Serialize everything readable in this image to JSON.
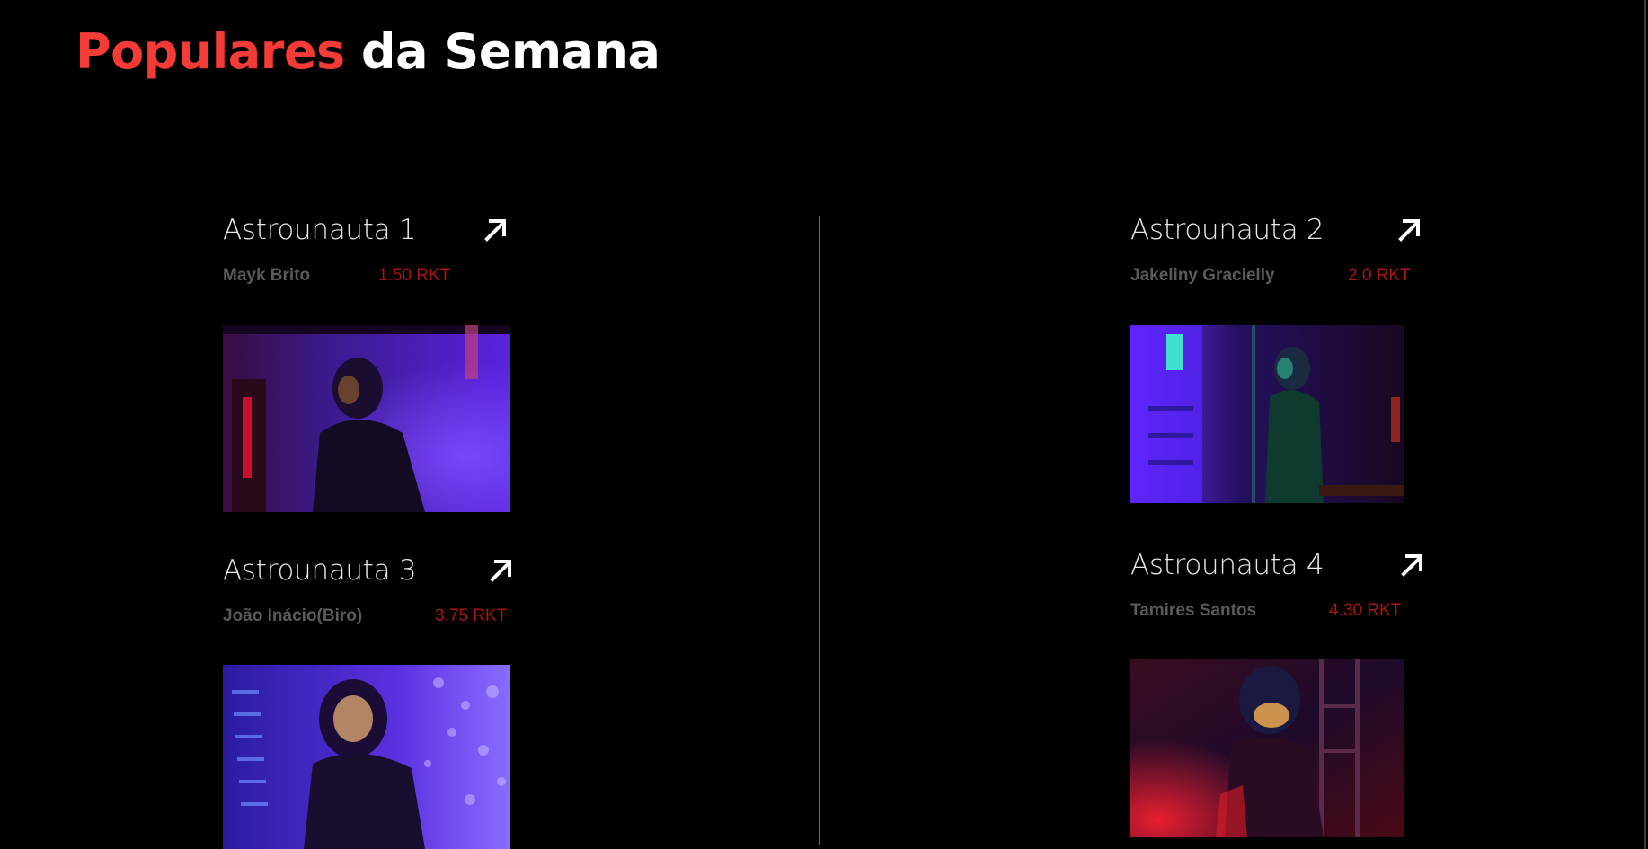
{
  "header": {
    "title_accent": "Populares",
    "title_rest": " da Semana"
  },
  "cards": [
    {
      "name": "Astrounauta 1",
      "author": "Mayk Brito",
      "price": "1.50 RKT",
      "link_icon": "arrow-up-right-icon"
    },
    {
      "name": "Astrounauta 2",
      "author": "Jakeliny Gracielly",
      "price": "2.0 RKT",
      "link_icon": "arrow-up-right-icon"
    },
    {
      "name": "Astrounauta 3",
      "author": "João Inácio(Biro)",
      "price": "3.75 RKT",
      "link_icon": "arrow-up-right-icon"
    },
    {
      "name": "Astrounauta 4",
      "author": "Tamires Santos",
      "price": "4.30 RKT",
      "link_icon": "arrow-up-right-icon"
    }
  ],
  "colors": {
    "accent": "#f53b36",
    "background": "#000000",
    "price": "#a8170f",
    "author": "#5a5a5a"
  }
}
